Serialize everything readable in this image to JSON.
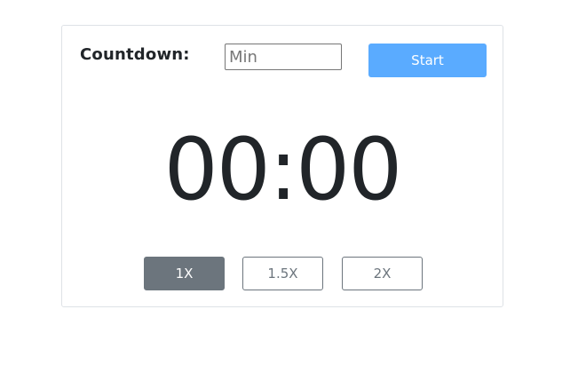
{
  "countdown": {
    "label": "Countdown:",
    "input_placeholder": "Min",
    "input_value": "",
    "start_label": "Start"
  },
  "timer": {
    "display": "00:00"
  },
  "speed": {
    "options": [
      {
        "label": "1X",
        "active": true
      },
      {
        "label": "1.5X",
        "active": false
      },
      {
        "label": "2X",
        "active": false
      }
    ]
  },
  "colors": {
    "start_button": "#5aabff",
    "active_speed": "#6c757d",
    "text": "#212529",
    "border": "#dee2e6"
  }
}
